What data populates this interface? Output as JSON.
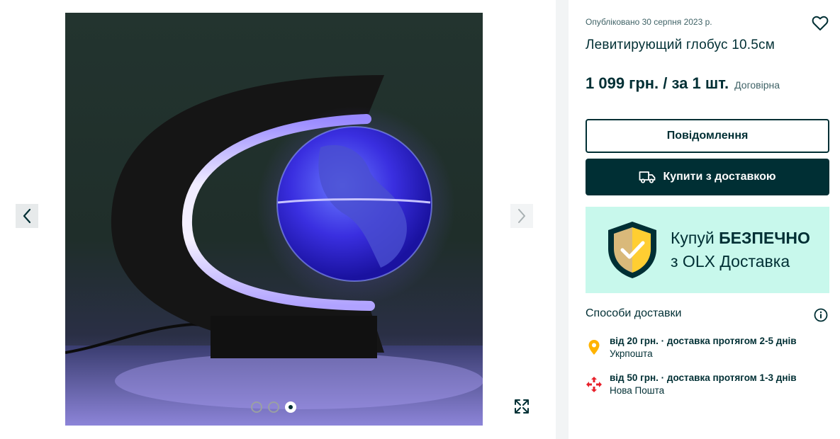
{
  "gallery": {
    "photo_alt": "Левитирующий глобус",
    "dots_count": 3,
    "active_dot": 3
  },
  "listing": {
    "posted": "Опубліковано 30 серпня 2023 р.",
    "title": "Левитирующий глобус 10.5см",
    "price": "1 099 грн. / за 1 шт.",
    "negotiable": "Договірна"
  },
  "actions": {
    "message_label": "Повідомлення",
    "buy_label": "Купити з доставкою"
  },
  "banner": {
    "line1_prefix": "Купуй ",
    "line1_bold": "БЕЗПЕЧНО",
    "line2": "з OLX Доставка"
  },
  "delivery": {
    "heading": "Способи доставки",
    "options": [
      {
        "main": "від 20 грн. · доставка протягом 2-5 днів",
        "carrier": "Укрпошта",
        "icon": "map-pin-icon"
      },
      {
        "main": "від 50 грн. · доставка протягом 1-3 днів",
        "carrier": "Нова Пошта",
        "icon": "nova-poshta-icon"
      }
    ]
  },
  "colors": {
    "primary": "#002f34",
    "banner_bg": "#c8f8ec",
    "pin": "#ffb300",
    "nova_poshta": "#e8202a"
  }
}
